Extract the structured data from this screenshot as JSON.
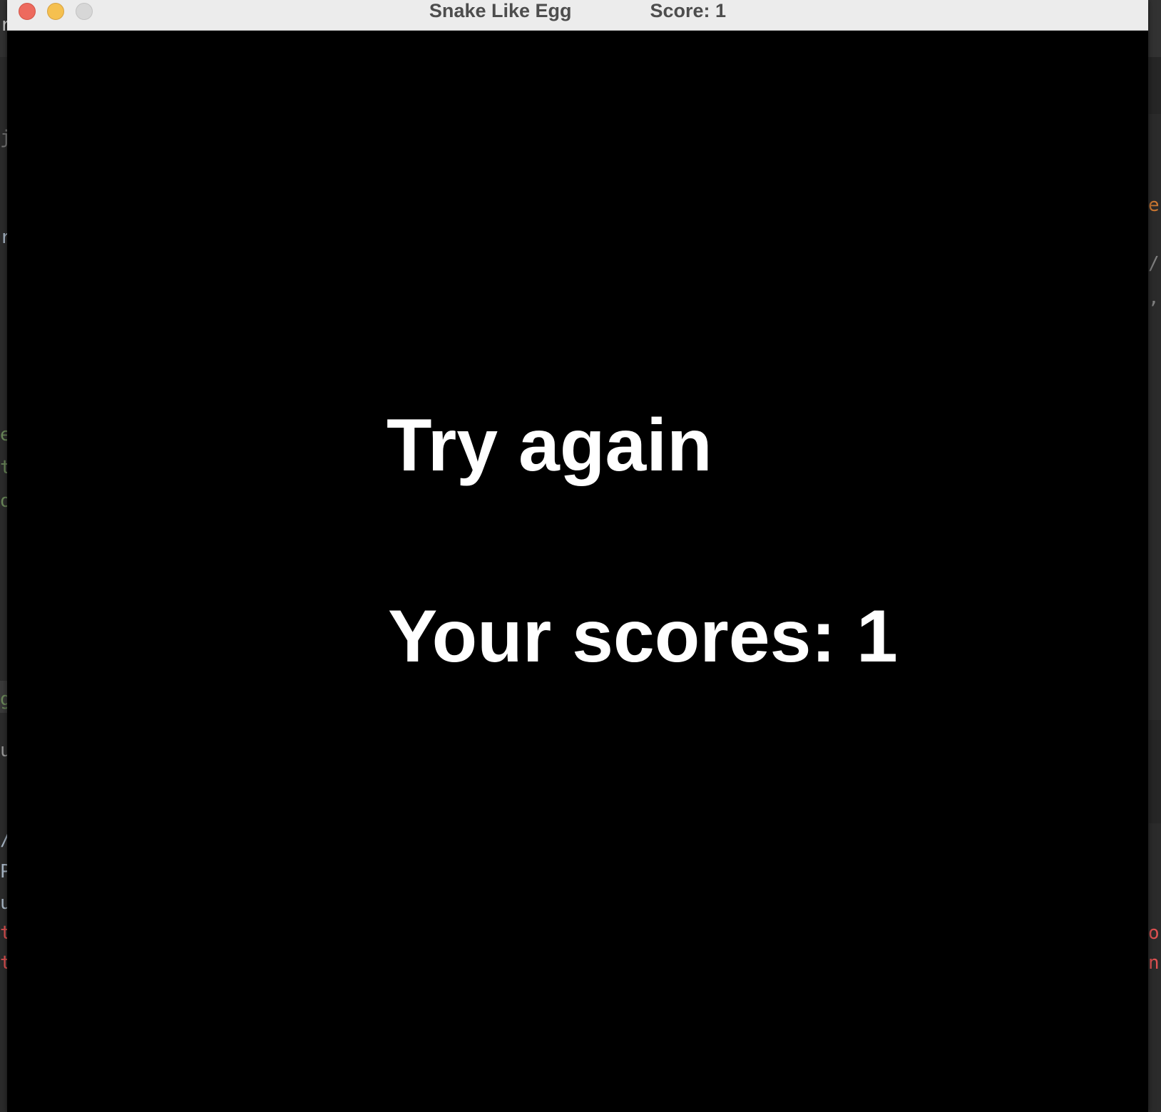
{
  "window": {
    "title": "Snake Like Egg",
    "score_label": "Score: 1"
  },
  "game": {
    "message": "Try again",
    "final_score_text": "Your scores: 1"
  },
  "background": {
    "left_fragments": [
      "r",
      "je",
      "ra",
      "e",
      "t_",
      "o",
      "g",
      "ug",
      "/",
      "P",
      "u",
      "t",
      "t"
    ],
    "right_fragments": [
      "e,",
      "/,",
      ",",
      "or",
      "nh"
    ]
  },
  "colors": {
    "window_background": "#000000",
    "titlebar": "#ececec",
    "text": "#ffffff",
    "close": "#ed6a5e",
    "minimize": "#f5c04f",
    "zoom": "#d7d7d7"
  }
}
